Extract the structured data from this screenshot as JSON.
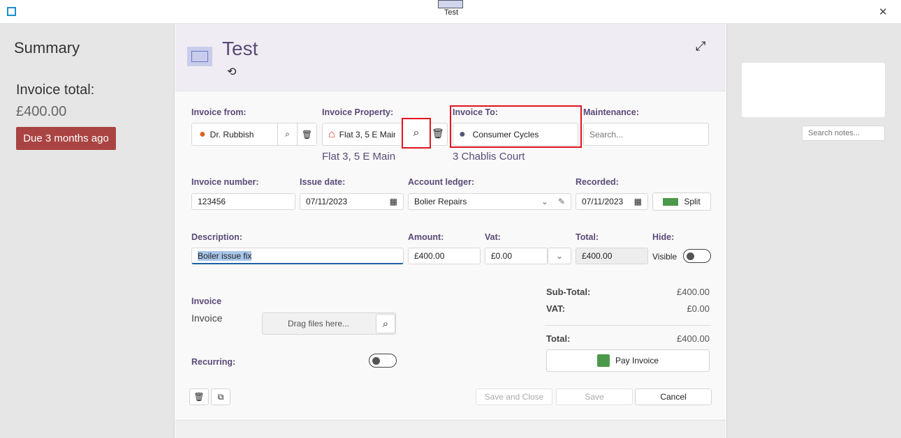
{
  "window": {
    "title": "Test",
    "close_icon": "✕"
  },
  "summary": {
    "heading": "Summary",
    "total_label": "Invoice total:",
    "total_value": "£400.00",
    "due_badge": "Due 3 months ago",
    "badge_color": "#a94442"
  },
  "header": {
    "title": "Test"
  },
  "fields": {
    "invoice_from": {
      "label": "Invoice from:",
      "value": "Dr. Rubbish"
    },
    "invoice_property": {
      "label": "Invoice Property:",
      "value": "Flat 3, 5 E Main",
      "subtext": "Flat 3, 5 E Main"
    },
    "invoice_to": {
      "label": "Invoice To:",
      "value": "Consumer Cycles",
      "subtext": "3 Chablis Court"
    },
    "maintenance": {
      "label": "Maintenance:",
      "placeholder": "Search..."
    },
    "invoice_number": {
      "label": "Invoice number:",
      "value": "123456"
    },
    "issue_date": {
      "label": "Issue date:",
      "value": "07/11/2023"
    },
    "account_ledger": {
      "label": "Account ledger:",
      "value": "Bolier Repairs"
    },
    "recorded": {
      "label": "Recorded:",
      "value": "07/11/2023"
    },
    "split_label": "Split",
    "description": {
      "label": "Description:",
      "value": "Boiler issue fix"
    },
    "amount": {
      "label": "Amount:",
      "value": "£400.00"
    },
    "vat": {
      "label": "Vat:",
      "value": "£0.00"
    },
    "total": {
      "label": "Total:",
      "value": "£400.00"
    },
    "hide": {
      "label": "Hide:",
      "state": "Visible"
    }
  },
  "invoice_section": {
    "heading": "Invoice",
    "label": "Invoice",
    "drop_placeholder": "Drag files here...",
    "recurring_label": "Recurring:"
  },
  "totals": {
    "subtotal_label": "Sub-Total:",
    "subtotal": "£400.00",
    "vat_label": "VAT:",
    "vat": "£0.00",
    "total_label": "Total:",
    "total": "£400.00",
    "pay_label": "Pay Invoice"
  },
  "actions": {
    "save_close": "Save and Close",
    "save": "Save",
    "cancel": "Cancel"
  },
  "notes": {
    "placeholder": "Search notes..."
  }
}
